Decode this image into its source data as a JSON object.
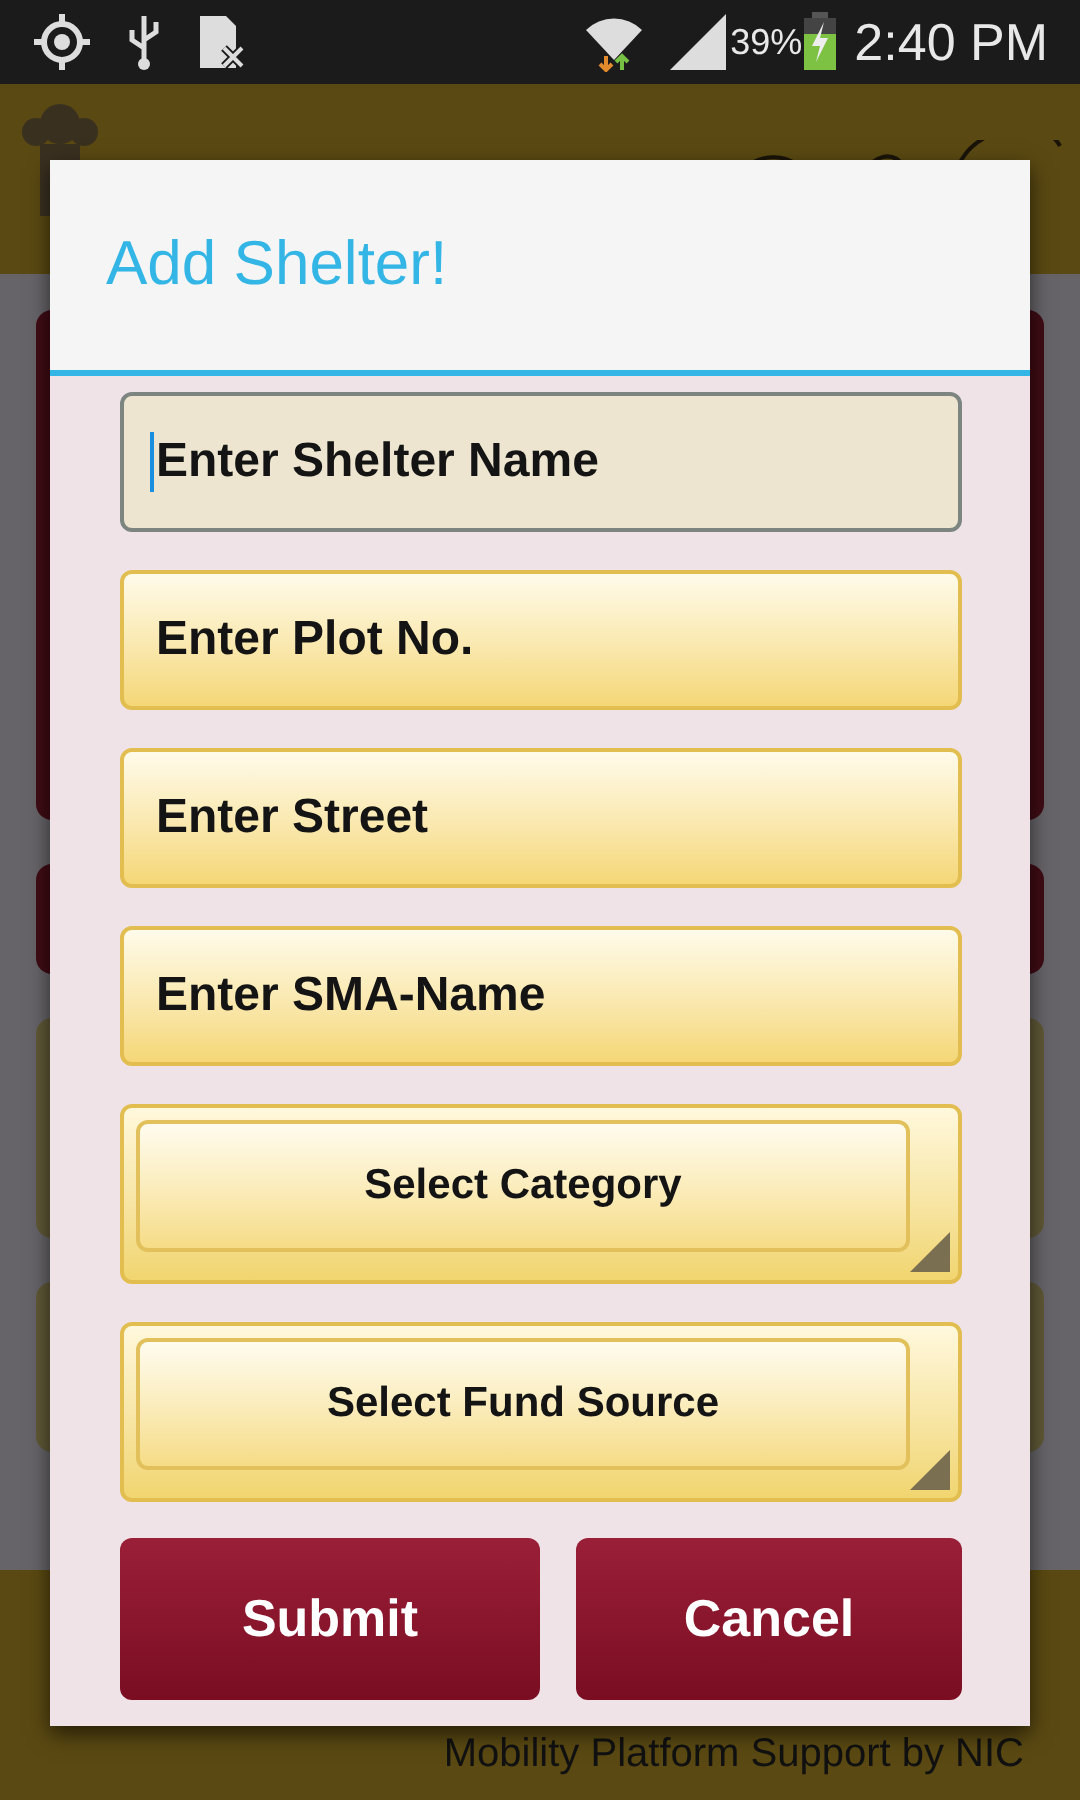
{
  "status_bar": {
    "battery": "39%",
    "time": "2:40 PM"
  },
  "footer": {
    "text": "Mobility Platform Support by NIC"
  },
  "dialog": {
    "title": "Add Shelter!",
    "fields": [
      {
        "kind": "text",
        "placeholder": "Enter Shelter Name",
        "focused": true
      },
      {
        "kind": "text",
        "placeholder": "Enter Plot No.",
        "focused": false
      },
      {
        "kind": "text",
        "placeholder": "Enter Street",
        "focused": false
      },
      {
        "kind": "text",
        "placeholder": "Enter SMA-Name",
        "focused": false
      },
      {
        "kind": "select",
        "label": "Select Category",
        "focused": false
      },
      {
        "kind": "select",
        "label": "Select Fund Source",
        "focused": false
      }
    ],
    "buttons": [
      "Submit",
      "Cancel"
    ]
  }
}
